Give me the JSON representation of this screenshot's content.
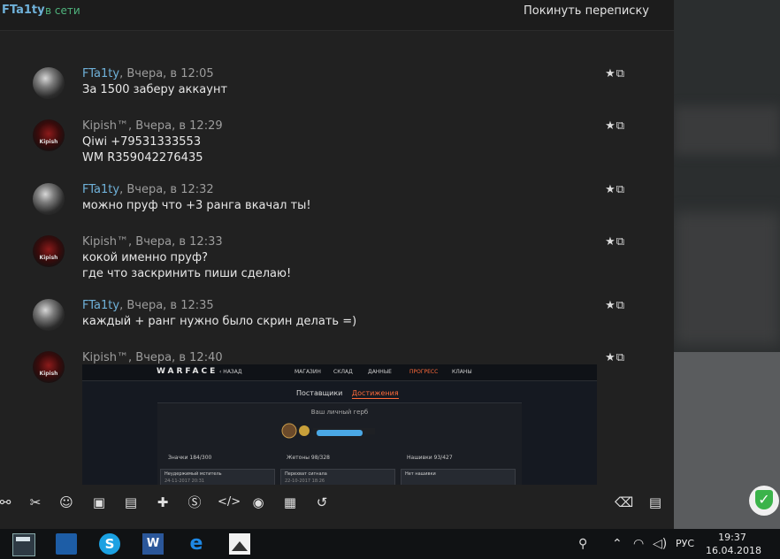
{
  "header": {
    "username": "FTa1ty",
    "status": "в сети",
    "leave_label": "Покинуть переписку"
  },
  "messages": [
    {
      "author": "FTa1ty",
      "time": ", Вчера, в 12:05",
      "lines": [
        "За 1500 заберу аккаунт"
      ]
    },
    {
      "author": "Kipish™",
      "time": ", Вчера, в 12:29",
      "lines": [
        "Qiwi +79531333553",
        "WM R359042276435"
      ]
    },
    {
      "author": "FTa1ty",
      "time": ", Вчера, в 12:32",
      "lines": [
        "можно пруф что +3 ранга вкачал ты!"
      ]
    },
    {
      "author": "Kipish™",
      "time": ", Вчера, в 12:33",
      "lines": [
        "кокой именно пруф?",
        "где что заскринить пиши сделаю!"
      ]
    },
    {
      "author": "FTa1ty",
      "time": ", Вчера, в 12:35",
      "lines": [
        "каждый + ранг нужно было скрин делать =)"
      ]
    },
    {
      "author": "Kipish™",
      "time": ", Вчера, в 12:40",
      "lines": []
    }
  ],
  "avatar_label_kipish": "Kipish",
  "message_actions": "★⧉",
  "screenshot": {
    "logo": "WARFACE",
    "back": "‹ НАЗАД",
    "nav": [
      "МАГАЗИН",
      "СКЛАД",
      "ДАННЫЕ",
      "ПРОГРЕСС",
      "КЛАНЫ"
    ],
    "tabs": [
      "Поставщики",
      "Достижения"
    ],
    "panel_title": "Ваш личный герб",
    "stats": [
      "Значки 184/300",
      "Жетоны 98/328",
      "Нашивки 93/427"
    ],
    "cards": [
      "Неудержимый мститель",
      "Перехват сигнала",
      "Нет нашивки"
    ],
    "dates": [
      "24-11-2017 20:31",
      "22-10-2017 18:26"
    ]
  },
  "toolbar_icons": [
    "link-icon",
    "unlink-icon",
    "emoji-icon",
    "image-icon",
    "video-icon",
    "plus-icon",
    "skype-icon",
    "code-icon",
    "hide-icon",
    "save-icon",
    "undo-icon",
    "eraser-icon",
    "document-icon"
  ],
  "taskbar": {
    "lang": "РУС",
    "time": "19:37",
    "date": "16.04.2018",
    "word_label": "W",
    "skype_label": "S",
    "edge_label": "e"
  },
  "colors": {
    "link": "#6fb1d9",
    "online": "#4fb37d",
    "accent": "#ff6a3a"
  }
}
